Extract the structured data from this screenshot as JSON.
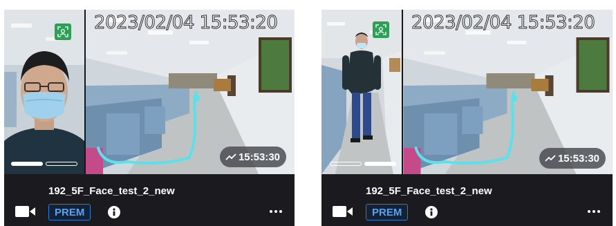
{
  "cards": [
    {
      "timestamp": "2023/02/04 15:53:20",
      "clip_time": "15:53:30",
      "camera_name": "192_5F_Face_test_2_new",
      "badge": "PREM",
      "active_pager_segment": 1,
      "icons": [
        "face-detect-icon",
        "trend-icon",
        "camera-icon",
        "info-icon",
        "more-icon"
      ]
    },
    {
      "timestamp": "2023/02/04 15:53:20",
      "clip_time": "15:53:30",
      "camera_name": "192_5F_Face_test_2_new",
      "badge": "PREM",
      "active_pager_segment": 2,
      "icons": [
        "face-detect-icon",
        "trend-icon",
        "camera-icon",
        "info-icon",
        "more-icon"
      ]
    }
  ],
  "colors": {
    "card_background": "#1b1b1f",
    "trajectory": "#5de0ea",
    "face_icon": "#2f9e57",
    "prem_text": "#5aa2f2",
    "prem_border": "#2e7bd6"
  }
}
